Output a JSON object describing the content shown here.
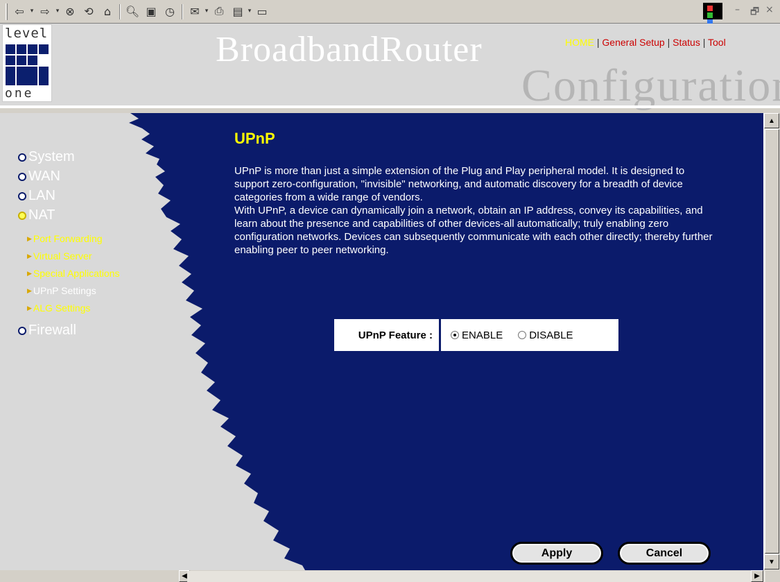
{
  "toolbar": {
    "icons": [
      "back-icon",
      "forward-icon",
      "stop-icon",
      "refresh-icon",
      "home-icon",
      "search-icon",
      "favorites-icon",
      "history-icon",
      "mail-icon",
      "print-icon",
      "edit-icon",
      "discuss-icon"
    ],
    "window_controls": {
      "minimize": "–",
      "restore": "🗗",
      "close": "×"
    }
  },
  "header": {
    "logo_top": "level",
    "logo_bottom": "one",
    "title": "BroadbandRouter",
    "subtitle": "Configuration",
    "nav": {
      "home": "HOME",
      "sep": " | ",
      "general_setup": "General Setup",
      "status": "Status",
      "tool": "Tool"
    }
  },
  "sidebar": {
    "items": [
      {
        "label": "System"
      },
      {
        "label": "WAN"
      },
      {
        "label": "LAN"
      },
      {
        "label": "NAT"
      },
      {
        "label": "Firewall"
      }
    ],
    "nat_subitems": [
      {
        "label": "Port Forwarding"
      },
      {
        "label": "Virtual Server"
      },
      {
        "label": "Special Applications"
      },
      {
        "label": "UPnP Settings"
      },
      {
        "label": "ALG Settings"
      }
    ]
  },
  "main": {
    "title": "UPnP",
    "description_1": "UPnP is more than just a simple extension of the Plug and Play peripheral model. It is designed to support zero-configuration, \"invisible\" networking, and automatic discovery for a breadth of device categories from a wide range of vendors.",
    "description_2": "With UPnP, a device can dynamically join a network, obtain an IP address, convey its capabilities, and learn about the presence and capabilities of other devices-all automatically; truly enabling zero configuration networks. Devices can subsequently communicate with each other directly; thereby further enabling peer to peer networking.",
    "upnp_feature_label": "UPnP Feature :",
    "enable_label": "ENABLE",
    "disable_label": "DISABLE",
    "selected": "ENABLE",
    "apply_label": "Apply",
    "cancel_label": "Cancel"
  },
  "colors": {
    "content_bg": "#0b1b6b",
    "sidebar_bg": "#d9d9d9",
    "title_yellow": "#ffff00",
    "nav_red": "#cc0000"
  }
}
